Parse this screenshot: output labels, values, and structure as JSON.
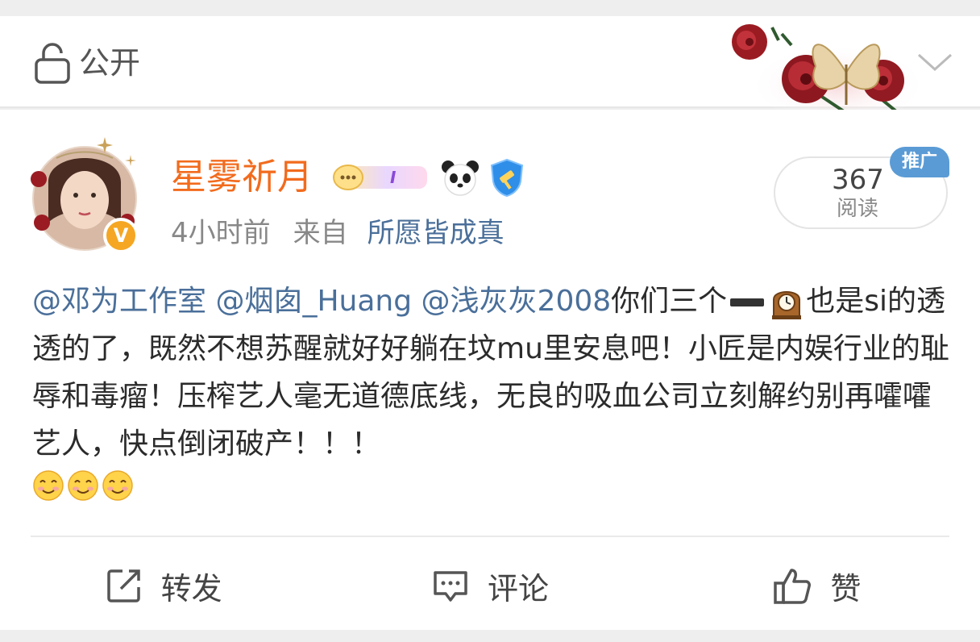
{
  "header": {
    "visibility_label": "公开",
    "icons": {
      "visibility": "lock-open-icon",
      "expand": "chevron-down-icon",
      "decoration": "rose-butterfly-decoration"
    }
  },
  "post": {
    "username": "星雾祈月",
    "username_color": "#f26b1d",
    "timestamp": "4小时前",
    "source_prefix": "来自",
    "source": "所愿皆成真",
    "read_count": "367",
    "read_label": "阅读",
    "promo_tag": "推广",
    "verified_badge": "V",
    "mentions": [
      "@邓为工作室",
      "@烟囱_Huang",
      "@浅灰灰2008"
    ],
    "text_after_mentions": "你们三个",
    "text_body": "也是si的透透的了，既然不想苏醒就好好躺在坟mu里安息吧！小匠是内娱行业的耻辱和毒瘤！压榨艺人毫无道德底线，无良的吸血公司立刻解约别再嚯嚯艺人，快点倒闭破产！！！",
    "inline_emojis": [
      "dash-emoji",
      "mantelpiece-clock-emoji"
    ],
    "trailing_emojis": [
      "smile-emoji",
      "smile-emoji",
      "smile-emoji"
    ]
  },
  "actions": {
    "repost": "转发",
    "comment": "评论",
    "like": "赞"
  },
  "colors": {
    "link": "#4a6f9a",
    "username": "#f26b1d",
    "promo": "#5b9bd5",
    "badge_v": "#f5a623"
  }
}
